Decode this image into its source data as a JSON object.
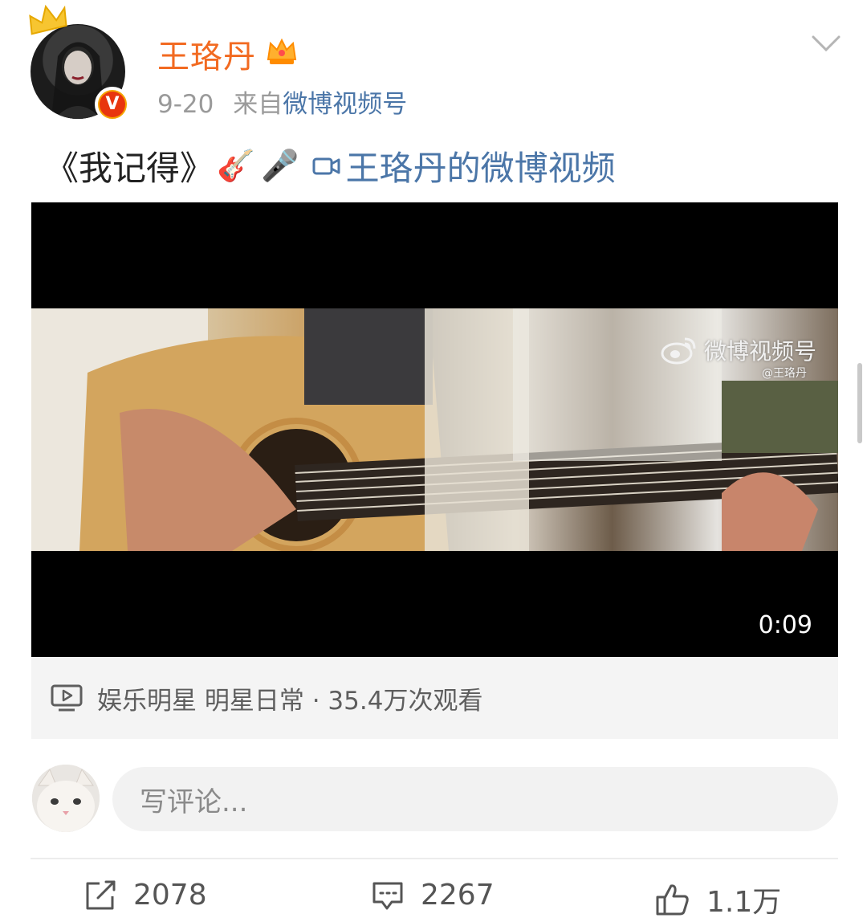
{
  "header": {
    "username": "王珞丹",
    "date": "9-20",
    "source_prefix": "来自",
    "source_name": "微博视频号",
    "avatar_badge": "V",
    "icons": [
      "crown-icon",
      "vip-crown-icon",
      "chevron-down-icon"
    ]
  },
  "post": {
    "text": "《我记得》",
    "emojis": [
      "🎸",
      "🎤"
    ],
    "video_link": "王珞丹的微博视频"
  },
  "video": {
    "watermark": "微博视频号",
    "watermark_user": "@王珞丹",
    "duration": "0:09",
    "info": "娱乐明星 明星日常 · 35.4万次观看"
  },
  "comment": {
    "placeholder": "写评论..."
  },
  "actions": {
    "repost_count": "2078",
    "comment_count": "2267",
    "like_count": "1.1万"
  },
  "colors": {
    "username": "#f26a21",
    "link": "#4b76a8",
    "meta": "#9a9a9a"
  }
}
